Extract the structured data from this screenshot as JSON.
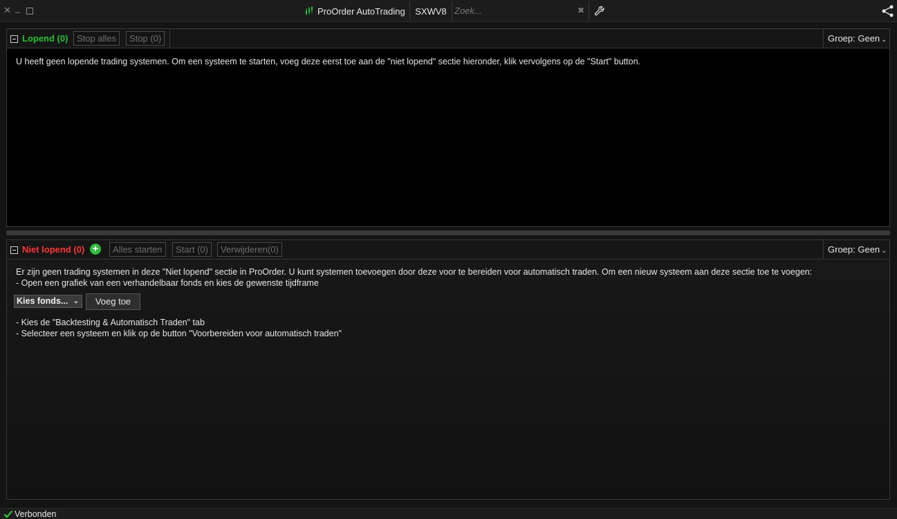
{
  "window": {
    "title": "ProOrder AutoTrading",
    "ticker": "SXWV8",
    "search_placeholder": "Zoek...",
    "icons": {
      "close": "close-icon",
      "minimize": "minimize-icon",
      "maximize": "maximize-icon",
      "app": "candlestick-chart-icon",
      "wrench": "wrench-icon",
      "share": "share-icon"
    },
    "accent": "#2ebd3c"
  },
  "running": {
    "title": "Lopend (0)",
    "title_color": "#21c231",
    "buttons": {
      "stop_all": "Stop alles",
      "stop": "Stop (0)"
    },
    "group_label": "Groep: Geen",
    "message": "U heeft geen lopende trading systemen. Om een systeem te starten, voeg deze eerst toe aan de \"niet lopend\" sectie hieronder, klik vervolgens op de \"Start\" button."
  },
  "stopped": {
    "title": "Niet lopend (0)",
    "title_color": "#ff3535",
    "buttons": {
      "start_all": "Alles starten",
      "start": "Start (0)",
      "delete": "Verwijderen(0)"
    },
    "group_label": "Groep: Geen",
    "message_line1": "Er zijn geen trading systemen in deze \"Niet lopend\" sectie in ProOrder. U kunt systemen toevoegen door deze voor te bereiden voor automatisch traden. Om een nieuw systeem aan deze sectie toe te voegen:",
    "message_line2": "- Open een grafiek van een verhandelbaar fonds en kies de gewenste tijdframe",
    "fund_select": "Kies fonds...",
    "add_button": "Voeg toe",
    "message_line3": "- Kies de \"Backtesting & Automatisch Traden\" tab",
    "message_line4": "- Selecteer een systeem en klik op de button \"Voorbereiden voor automatisch traden\""
  },
  "status": {
    "text": "Verbonden",
    "color": "#2ebd3c"
  }
}
